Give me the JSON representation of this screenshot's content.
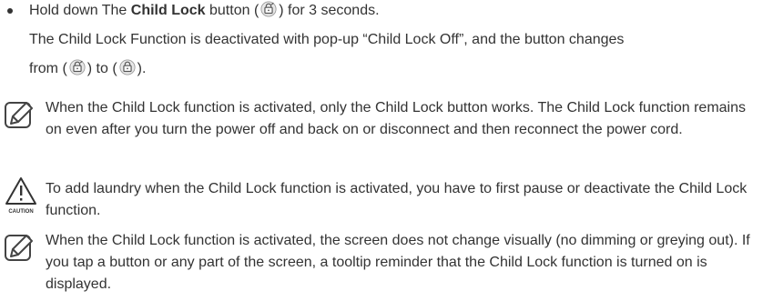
{
  "bullet": {
    "line1_prefix": "Hold down The ",
    "line1_bold": "Child Lock",
    "line1_suffix_before_icon": " button (",
    "line1_suffix_after_icon": ") for 3 seconds.",
    "line2": "The Child Lock Function is deactivated with pop-up “Child Lock Off”, and the button changes",
    "line3_prefix": "from (",
    "line3_mid": ") to (",
    "line3_suffix": ")."
  },
  "note1": {
    "text": "When the Child Lock function is activated, only the Child Lock button works. The Child Lock function remains on even after you turn the power off and back on or disconnect and then reconnect the power cord."
  },
  "caution": {
    "label": "CAUTION",
    "text": "To add laundry when the Child Lock function is activated, you have to first pause or deactivate the Child Lock function."
  },
  "note2": {
    "text": "When the Child Lock function is activated, the screen does not change visually (no dimming or greying out). If you tap a button or any part of the screen, a tooltip reminder that the Child Lock function is turned on is displayed."
  },
  "icons": {
    "child_lock_icon": "child-lock-icon",
    "note_icon": "pencil-note-icon",
    "caution_icon": "warning-triangle-icon"
  }
}
